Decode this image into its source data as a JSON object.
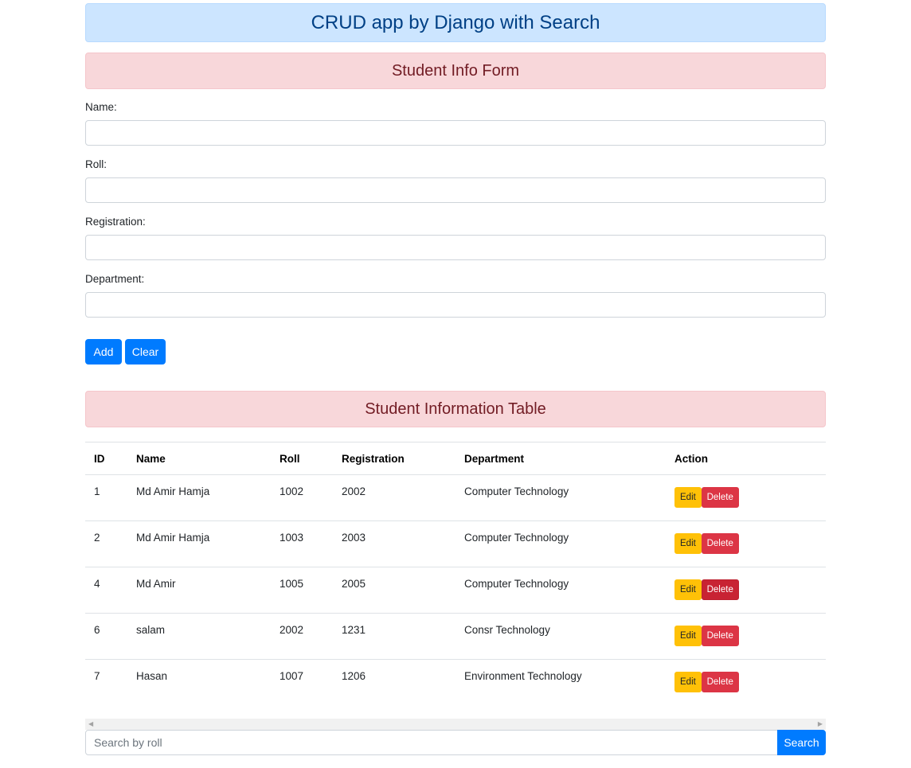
{
  "header": {
    "title": "CRUD app by Django with Search"
  },
  "form": {
    "title": "Student Info Form",
    "fields": [
      {
        "label": "Name:",
        "value": ""
      },
      {
        "label": "Roll:",
        "value": ""
      },
      {
        "label": "Registration:",
        "value": ""
      },
      {
        "label": "Department:",
        "value": ""
      }
    ],
    "add_label": "Add",
    "clear_label": "Clear"
  },
  "table": {
    "title": "Student Information Table",
    "columns": [
      "ID",
      "Name",
      "Roll",
      "Registration",
      "Department",
      "Action"
    ],
    "rows": [
      {
        "id": "1",
        "name": "Md Amir Hamja",
        "roll": "1002",
        "registration": "2002",
        "department": "Computer Technology"
      },
      {
        "id": "2",
        "name": "Md Amir Hamja",
        "roll": "1003",
        "registration": "2003",
        "department": "Computer Technology"
      },
      {
        "id": "4",
        "name": "Md Amir",
        "roll": "1005",
        "registration": "2005",
        "department": "Computer Technology"
      },
      {
        "id": "6",
        "name": "salam",
        "roll": "2002",
        "registration": "1231",
        "department": "Consr Technology"
      },
      {
        "id": "7",
        "name": "Hasan",
        "roll": "1007",
        "registration": "1206",
        "department": "Environment Technology"
      }
    ],
    "edit_label": "Edit",
    "delete_label": "Delete"
  },
  "scrollbar": {
    "left_icon": "scroll-left-arrow-icon",
    "right_icon": "scroll-right-arrow-icon"
  },
  "search": {
    "placeholder": "Search by roll",
    "button_label": "Search"
  },
  "colors": {
    "primary": "#007bff",
    "warning": "#ffc107",
    "danger": "#dc3545",
    "info_bg": "#cce5ff",
    "alert_bg": "#f8d7da"
  }
}
